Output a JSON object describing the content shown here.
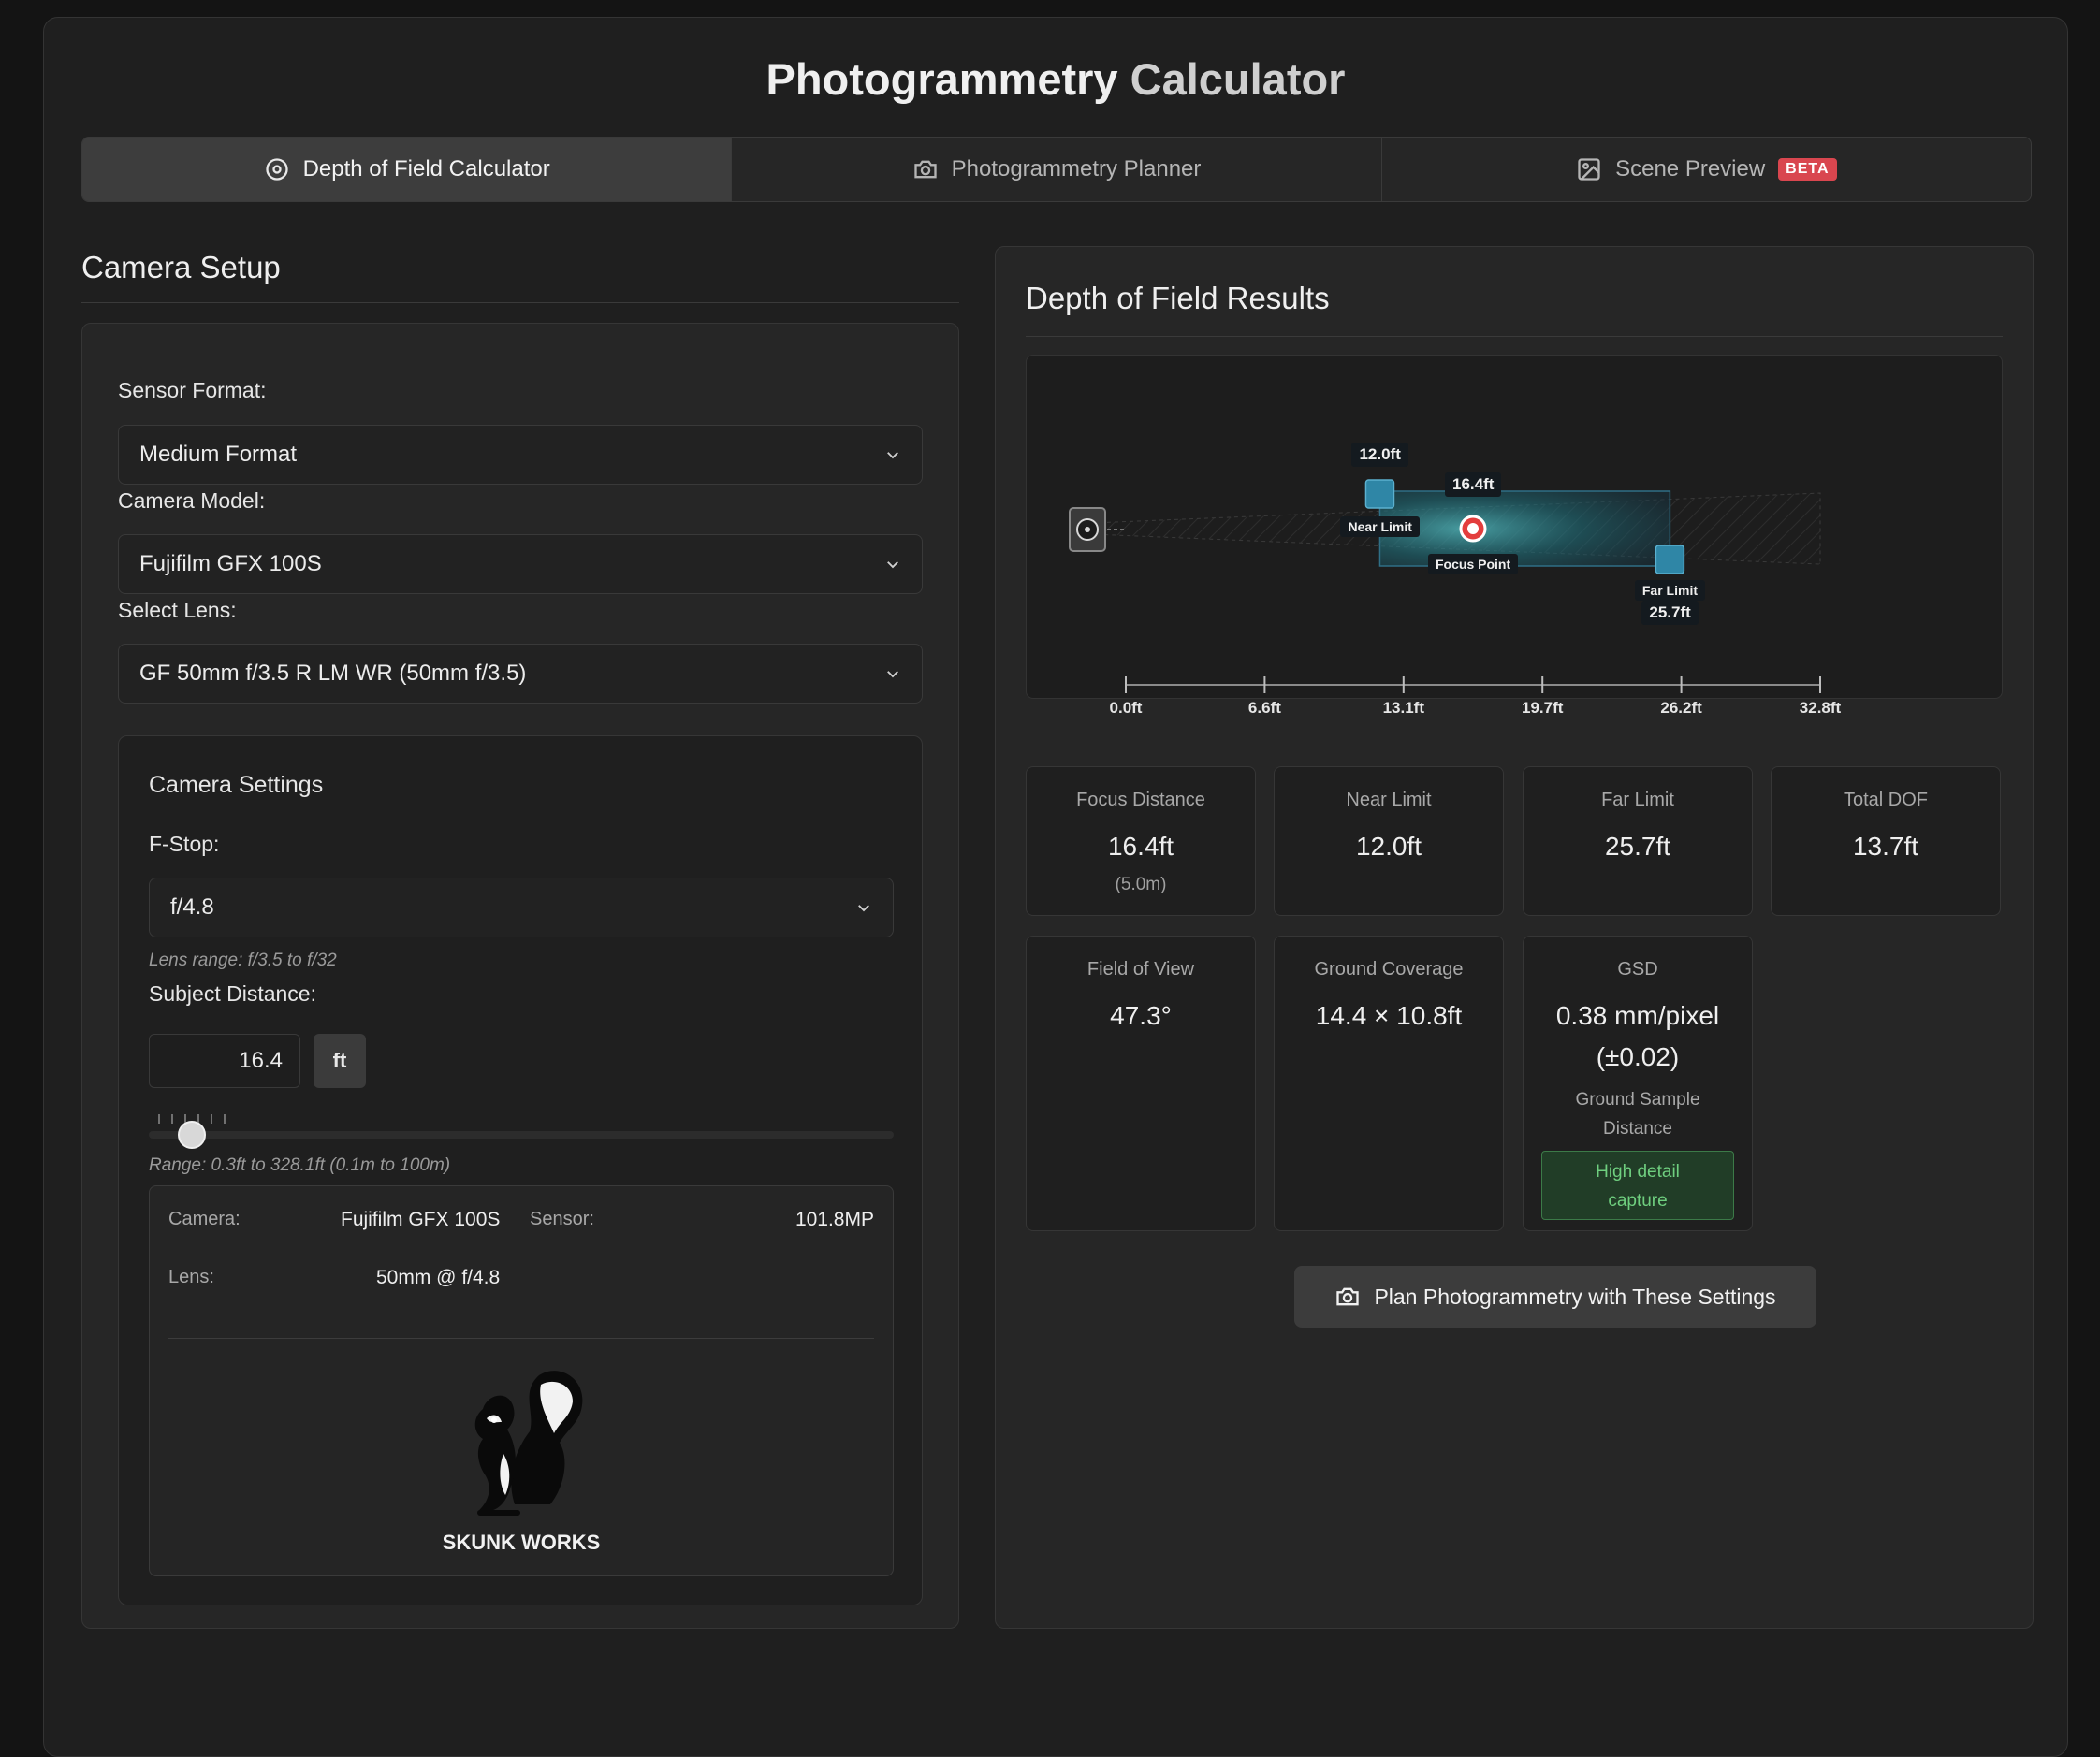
{
  "app_title": {
    "part1": "Photogrammetry",
    "part2": "Calculator"
  },
  "tabs": [
    {
      "label": "Depth of Field Calculator",
      "icon": "target-icon",
      "active": true
    },
    {
      "label": "Photogrammetry Planner",
      "icon": "camera-icon",
      "active": false
    },
    {
      "label": "Scene Preview",
      "icon": "image-icon",
      "active": false,
      "badge": "BETA"
    }
  ],
  "camera_setup": {
    "title": "Camera Setup",
    "sensor_format": {
      "label": "Sensor Format:",
      "value": "Medium Format"
    },
    "camera_model": {
      "label": "Camera Model:",
      "value": "Fujifilm GFX 100S"
    },
    "lens": {
      "label": "Select Lens:",
      "value": "GF 50mm f/3.5 R LM WR (50mm f/3.5)"
    },
    "settings": {
      "title": "Camera Settings",
      "fstop": {
        "label": "F-Stop:",
        "value": "f/4.8",
        "note": "Lens range: f/3.5 to f/32"
      },
      "subject_distance": {
        "label": "Subject Distance:",
        "value": "16.4",
        "unit": "ft",
        "slider_fraction": 0.05,
        "range_note": "Range: 0.3ft to 328.1ft (0.1m to 100m)"
      }
    },
    "summary": {
      "camera_key": "Camera:",
      "camera_value": "Fujifilm GFX 100S",
      "sensor_key": "Sensor:",
      "sensor_value": "101.8MP",
      "lens_key": "Lens:",
      "lens_value": "50mm @ f/4.8"
    },
    "logo_text": "SKUNK WORKS"
  },
  "results": {
    "title": "Depth of Field Results",
    "visual": {
      "axis_ticks": [
        "0.0ft",
        "6.6ft",
        "13.1ft",
        "19.7ft",
        "26.2ft",
        "32.8ft"
      ],
      "axis_max_ft": 32.8,
      "near_ft": 12.0,
      "focus_ft": 16.4,
      "far_ft": 25.7,
      "near_value": "12.0ft",
      "near_label": "Near Limit",
      "focus_value": "16.4ft",
      "focus_label": "Focus Point",
      "far_label": "Far Limit",
      "far_value": "25.7ft"
    },
    "stats": {
      "focus": {
        "label": "Focus Distance",
        "value": "16.4ft",
        "sub": "(5.0m)"
      },
      "near": {
        "label": "Near Limit",
        "value": "12.0ft"
      },
      "far": {
        "label": "Far Limit",
        "value": "25.7ft"
      },
      "total": {
        "label": "Total DOF",
        "value": "13.7ft"
      },
      "fov": {
        "label": "Field of View",
        "value": "47.3°"
      },
      "coverage": {
        "label": "Ground Coverage",
        "value": "14.4 × 10.8ft"
      },
      "gsd": {
        "label": "GSD",
        "value1": "0.38 mm/pixel",
        "value2": "(±0.02)",
        "desc1": "Ground Sample",
        "desc2": "Distance",
        "badge1": "High detail",
        "badge2": "capture"
      }
    },
    "plan_button": "Plan Photogrammetry with These Settings"
  }
}
